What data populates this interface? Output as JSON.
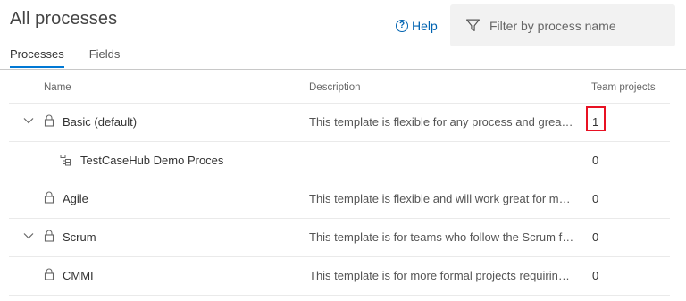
{
  "page": {
    "title": "All processes"
  },
  "help": {
    "label": "Help",
    "icon": "help-circle-icon"
  },
  "filter": {
    "placeholder": "Filter by process name",
    "icon": "filter-funnel-icon"
  },
  "tabs": [
    {
      "label": "Processes",
      "active": true
    },
    {
      "label": "Fields",
      "active": false
    }
  ],
  "table": {
    "columns": {
      "name": "Name",
      "description": "Description",
      "team_projects": "Team projects"
    },
    "rows": [
      {
        "name": "Basic (default)",
        "description": "This template is flexible for any process and great for teams getting started with Azure DevOps.",
        "team_projects": "1",
        "expanded": true,
        "icon": "lock-icon"
      },
      {
        "name": "TestCaseHub Demo Proces",
        "description": "",
        "team_projects": "0",
        "icon": "inherited-process-icon"
      },
      {
        "name": "Agile",
        "description": "This template is flexible and will work great for most teams using Agile planning methods.",
        "team_projects": "0",
        "icon": "lock-icon"
      },
      {
        "name": "Scrum",
        "description": "This template is for teams who follow the Scrum framework.",
        "team_projects": "0",
        "expanded": false,
        "icon": "lock-icon"
      },
      {
        "name": "CMMI",
        "description": "This template is for more formal projects requiring a framework for process improvement and an auditable record of decisions.",
        "team_projects": "0",
        "icon": "lock-icon"
      }
    ]
  },
  "colors": {
    "accent": "#0078d4",
    "link": "#0063b1",
    "highlight_box": "#e81123",
    "filter_bg": "#f2f2f2"
  }
}
